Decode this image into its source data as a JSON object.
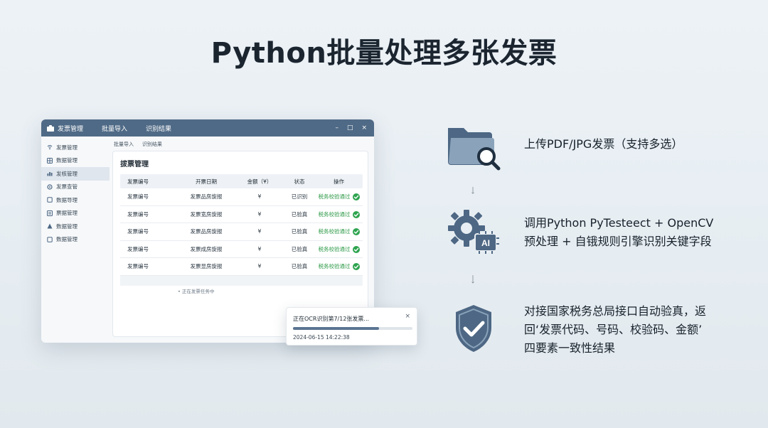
{
  "headline": "Python批量处理多张发票",
  "window": {
    "title": "发票管理",
    "tabs": [
      "批量导入",
      "识别结果"
    ],
    "controls": [
      "–",
      "□",
      "×"
    ],
    "sidebar": [
      {
        "label": "发票管理",
        "icon": "wifi-icon"
      },
      {
        "label": "数据管理",
        "icon": "grid-icon"
      },
      {
        "label": "发核管理",
        "icon": "chart-icon"
      },
      {
        "label": "发票查管",
        "icon": "gear-icon"
      },
      {
        "label": "数据导理",
        "icon": "square-icon"
      },
      {
        "label": "票据管理",
        "icon": "list-icon"
      },
      {
        "label": "数据管理",
        "icon": "warning-icon"
      },
      {
        "label": "数据管理",
        "icon": "square-icon"
      }
    ],
    "active_sidebar_index": 2,
    "breadcrumbs": [
      "批量导入",
      "识别结果"
    ],
    "panel_title": "拔票管理",
    "table": {
      "headers": [
        "发票编号",
        "开票日期",
        "金额（¥）",
        "状态",
        "操作"
      ],
      "rows": [
        {
          "no": "发票编号",
          "date": "发票品房旋报",
          "amount": "¥",
          "status": "已识别",
          "action": "税务校验通过"
        },
        {
          "no": "发票编号",
          "date": "发票宽房旋报",
          "amount": "¥",
          "status": "已验真",
          "action": "税务校验通过"
        },
        {
          "no": "发票编号",
          "date": "发票品房旋报",
          "amount": "¥",
          "status": "已验真",
          "action": "税务校验通过"
        },
        {
          "no": "发票编号",
          "date": "发票成房旋报",
          "amount": "¥",
          "status": "已验真",
          "action": "税务校验通过"
        },
        {
          "no": "发票编号",
          "date": "发票显房旋报",
          "amount": "¥",
          "status": "已验真",
          "action": "税务校验通过"
        }
      ]
    },
    "footer_note": "• 正在发票任务中"
  },
  "toast": {
    "message": "正在OCR识别第7/12张发票...",
    "close": "×",
    "progress": 0.72,
    "timestamp": "2024-06-15 14:22:38"
  },
  "features": [
    {
      "icon": "folder-search-icon",
      "lines": [
        "上传PDF/JPG发票（支持多选）"
      ]
    },
    {
      "icon": "gear-ai-icon",
      "lines": [
        "调用Python PyTesteect  + OpenCV",
        "预处理 + 自锇规则引擎识别关键字段"
      ]
    },
    {
      "icon": "shield-check-icon",
      "lines": [
        "对接国家税务总局接口自动验真，返",
        "回‘发票代码、号码、校验码、金额’",
        "四要素一致性结果"
      ]
    }
  ],
  "colors": {
    "titlebar": "#4f6a86",
    "icon_fill": "#5b7592",
    "success": "#2ea44f",
    "background": "#e8eef3"
  }
}
